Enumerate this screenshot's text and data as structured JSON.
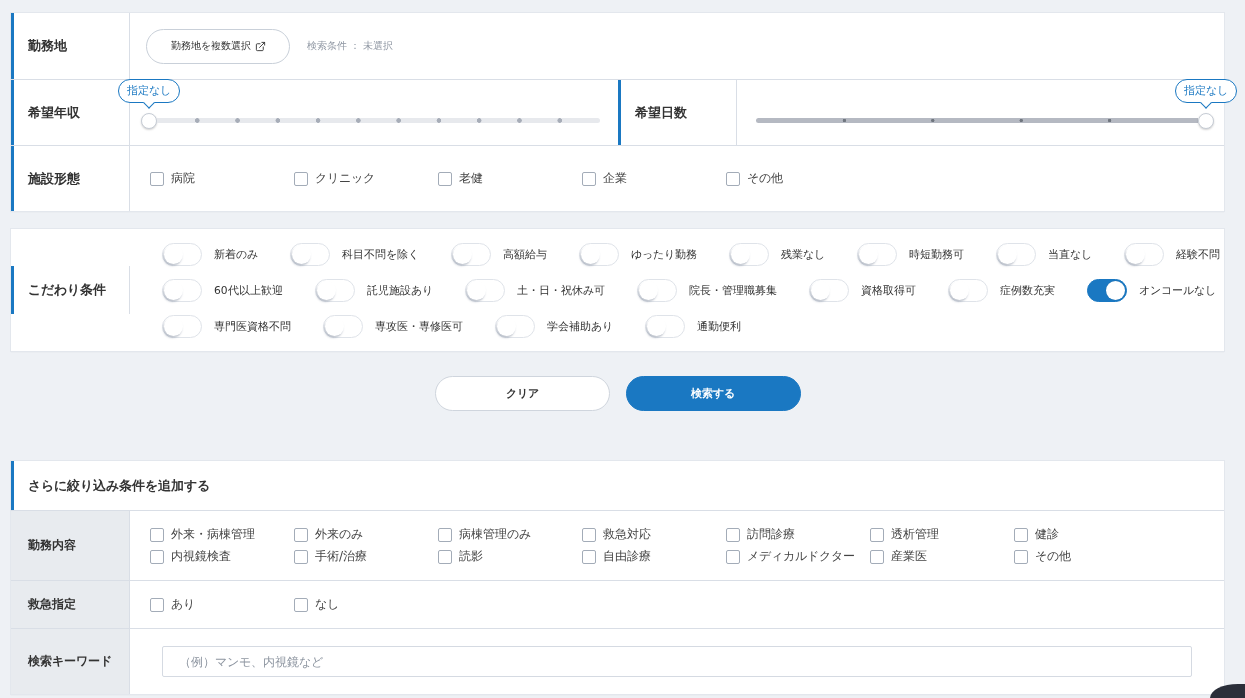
{
  "conditions": {
    "location": {
      "label": "勤務地",
      "button": "勤務地を複数選択",
      "status": "検索条件 ： 未選択"
    },
    "sliders": [
      {
        "label": "希望年収",
        "kind": "dotted",
        "level": 0,
        "tooltip": "指定なし"
      },
      {
        "label": "希望日数",
        "kind": "notched",
        "level": 1,
        "tooltip": "指定なし"
      }
    ],
    "facility": {
      "label": "施設形態",
      "options": [
        {
          "label": "病院",
          "checked": false
        },
        {
          "label": "クリニック",
          "checked": false
        },
        {
          "label": "老健",
          "checked": false
        },
        {
          "label": "企業",
          "checked": false
        },
        {
          "label": "その他",
          "checked": false
        }
      ]
    }
  },
  "preferences": {
    "label": "こだわり条件",
    "toggles": [
      {
        "label": "新着のみ",
        "on": false
      },
      {
        "label": "科目不問を除く",
        "on": false
      },
      {
        "label": "高額給与",
        "on": false
      },
      {
        "label": "ゆったり勤務",
        "on": false
      },
      {
        "label": "残業なし",
        "on": false
      },
      {
        "label": "時短勤務可",
        "on": false
      },
      {
        "label": "当直なし",
        "on": false
      },
      {
        "label": "経験不問",
        "on": false
      },
      {
        "label": "60代以上歓迎",
        "on": false
      },
      {
        "label": "託児施設あり",
        "on": false
      },
      {
        "label": "土・日・祝休み可",
        "on": false
      },
      {
        "label": "院長・管理職募集",
        "on": false
      },
      {
        "label": "資格取得可",
        "on": false
      },
      {
        "label": "症例数充実",
        "on": false
      },
      {
        "label": "オンコールなし",
        "on": true
      },
      {
        "label": "専門医資格不問",
        "on": false
      },
      {
        "label": "専攻医・専修医可",
        "on": false
      },
      {
        "label": "学会補助あり",
        "on": false
      },
      {
        "label": "通勤便利",
        "on": false
      }
    ]
  },
  "buttons": [
    {
      "label": "クリア",
      "kind": "secondary"
    },
    {
      "label": "検索する",
      "kind": "primary"
    }
  ],
  "more_filters": {
    "title": "さらに絞り込み条件を追加する",
    "rows": [
      {
        "kind": "checkboxes",
        "label": "勤務内容",
        "options": [
          {
            "label": "外来・病棟管理",
            "checked": false
          },
          {
            "label": "外来のみ",
            "checked": false
          },
          {
            "label": "病棟管理のみ",
            "checked": false
          },
          {
            "label": "救急対応",
            "checked": false
          },
          {
            "label": "訪問診療",
            "checked": false
          },
          {
            "label": "透析管理",
            "checked": false
          },
          {
            "label": "健診",
            "checked": false
          },
          {
            "label": "内視鏡検査",
            "checked": false
          },
          {
            "label": "手術/治療",
            "checked": false
          },
          {
            "label": "読影",
            "checked": false
          },
          {
            "label": "自由診療",
            "checked": false
          },
          {
            "label": "メディカルドクター",
            "checked": false
          },
          {
            "label": "産業医",
            "checked": false
          },
          {
            "label": "その他",
            "checked": false
          }
        ]
      },
      {
        "kind": "checkboxes",
        "label": "救急指定",
        "options": [
          {
            "label": "あり",
            "checked": false
          },
          {
            "label": "なし",
            "checked": false
          }
        ]
      },
      {
        "kind": "keyword",
        "label": "検索キーワード",
        "placeholder": "（例）マンモ、内視鏡など"
      }
    ]
  }
}
